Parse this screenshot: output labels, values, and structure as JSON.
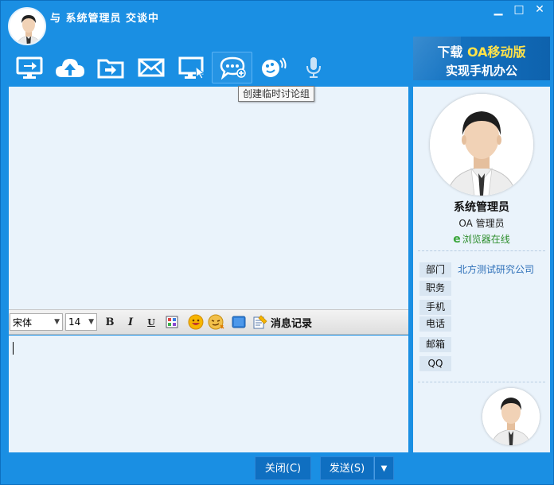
{
  "window": {
    "title": "与 系统管理员 交谈中",
    "minimize_glyph": "▁",
    "maximize_glyph": "□",
    "close_glyph": "✕"
  },
  "toolbar": {
    "items": [
      {
        "icon": "screen-share-icon"
      },
      {
        "icon": "cloud-upload-icon"
      },
      {
        "icon": "folder-send-icon"
      },
      {
        "icon": "mail-icon"
      },
      {
        "icon": "remote-desktop-icon"
      },
      {
        "icon": "chat-bubble-icon"
      },
      {
        "icon": "shake-icon"
      },
      {
        "icon": "microphone-icon"
      }
    ],
    "tooltip": "创建临时讨论组"
  },
  "banner": {
    "line1_prefix": "下载 ",
    "line1_highlight": "OA移动版",
    "line2": "实现手机办公",
    "highlight_color": "#ffe24a"
  },
  "format_bar": {
    "font_family": "宋体",
    "font_size": "14",
    "bold_label": "B",
    "italic_label": "I",
    "underline_label": "U",
    "history_label": "消息记录"
  },
  "buttons": {
    "close": "关闭(C)",
    "send": "发送(S)",
    "send_dropdown": "▼"
  },
  "profile": {
    "name": "系统管理员",
    "role": "OA 管理员",
    "status_icon": "e",
    "status": "浏览器在线",
    "status_color": "#2f8f2f",
    "fields": [
      {
        "label": "部门",
        "value": "北方测试研究公司"
      },
      {
        "label": "职务",
        "value": ""
      },
      {
        "label": "手机",
        "value": ""
      },
      {
        "label": "电话",
        "value": ""
      },
      {
        "label": "邮箱",
        "value": ""
      },
      {
        "label": "QQ",
        "value": ""
      }
    ]
  },
  "colors": {
    "window_blue": "#1a8fe3",
    "panel_bg": "#eaf3fb"
  }
}
